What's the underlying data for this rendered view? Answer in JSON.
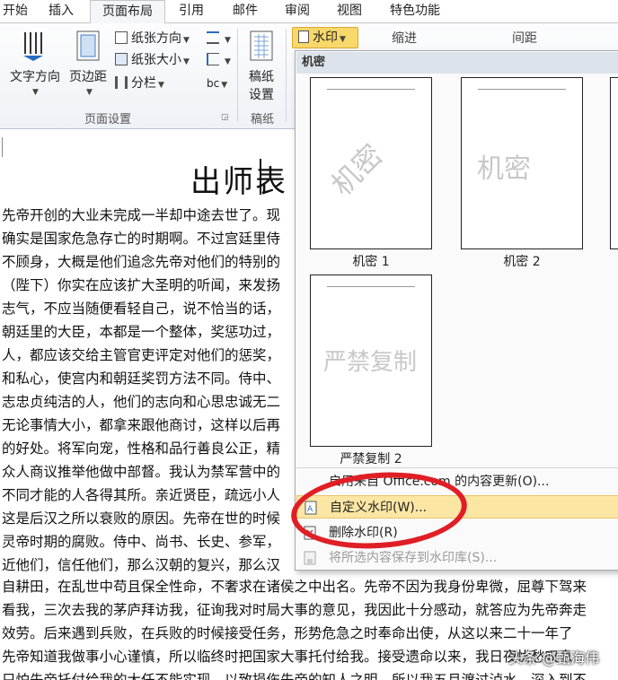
{
  "tabs": [
    "开始",
    "插入",
    "页面布局",
    "引用",
    "邮件",
    "审阅",
    "视图",
    "特色功能"
  ],
  "ribbon": {
    "text_direction": "文字方向",
    "margins": "页边距",
    "paper_direction": "纸张方向",
    "paper_size": "纸张大小",
    "columns": "分栏",
    "group_page_setup": "页面设置",
    "draft_line1": "稿纸",
    "draft_line2": "设置",
    "group_draft": "稿纸",
    "watermark_button": "水印",
    "indent": "缩进",
    "spacing": "间距"
  },
  "document": {
    "title": "出师表",
    "lines": [
      "先帝开创的大业未完成一半却中途去世了。现",
      "确实是国家危急存亡的时期啊。不过宫廷里侍",
      "不顾身，大概是他们追念先帝对他们的特别的",
      "（陛下）你实在应该扩大圣明的听闻，来发扬",
      "志气，不应当随便看轻自己，说不恰当的话，",
      "朝廷里的大臣，本都是一个整体，奖惩功过，",
      "人，都应该交给主管官吏评定对他们的惩奖，",
      "和私心，使宫内和朝廷奖罚方法不同。侍中、",
      "志忠贞纯洁的人，他们的志向和心思忠诚无二",
      "无论事情大小，都拿来跟他商讨，这样以后再",
      "的好处。将军向宠，性格和品行善良公正，精",
      "众人商议推举他做中部督。我认为禁军营中的",
      "不同才能的人各得其所。亲近贤臣，疏远小人",
      "这是后汉之所以衰败的原因。先帝在世的时候",
      "灵帝时期的腐败。侍中、尚书、长史、参军，",
      "近他们，信任他们，那么汉朝的复兴，那么汉",
      "自耕田，在乱世中苟且保全性命，不奢求在诸侯之中出名。先帝不因为我身份卑微，屈尊下驾来",
      "看我，三次去我的茅庐拜访我，征询我对时局大事的意见，我因此十分感动，就答应为先帝奔走",
      "效劳。后来遇到兵败，在兵败的时候接受任务，形势危急之时奉命出使，从这以来二十一年了",
      "先帝知道我做事小心谨慎，所以临终时把国家大事托付给我。接受遗命以来，我日夜忧愁叹息",
      "只怕先帝托付给我的大任不能实现，以致损伤先帝的知人之明，所以我五月渡过泸水，深入到不"
    ]
  },
  "menu": {
    "section_header": "机密",
    "thumbs": [
      {
        "text": "机密",
        "label": "机密 1"
      },
      {
        "text": "机密",
        "label": "机密 2"
      },
      {
        "text": "严禁复制",
        "label": "严禁复制 2"
      }
    ],
    "items": [
      "启用来自 Office.com 的内容更新(O)...",
      "自定义水印(W)...",
      "删除水印(R)",
      "将所选内容保存到水印库(S)..."
    ]
  },
  "credit": "头条 @甄海伟",
  "colors": {
    "accent_button": "#f8d86a",
    "highlight_item": "#fce6a4",
    "annotation_red": "#e01e26"
  }
}
